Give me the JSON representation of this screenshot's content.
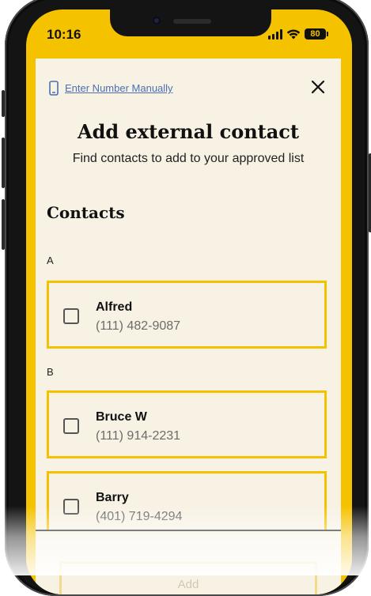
{
  "status_bar": {
    "time": "10:16",
    "battery": "80"
  },
  "header": {
    "manual_link_label": "Enter Number Manually",
    "title": "Add external contact",
    "subtitle": "Find contacts to add to your approved list"
  },
  "contacts": {
    "heading": "Contacts",
    "groups": [
      {
        "letter": "A",
        "items": [
          {
            "name": "Alfred",
            "phone": "(111) 482-9087",
            "checked": false
          }
        ]
      },
      {
        "letter": "B",
        "items": [
          {
            "name": "Bruce W",
            "phone": "(111) 914-2231",
            "checked": false
          },
          {
            "name": "Barry",
            "phone": "(401) 719-4294",
            "checked": false
          }
        ]
      }
    ]
  },
  "footer": {
    "add_label": "Add"
  },
  "colors": {
    "accent": "#f5c200",
    "sheet_background": "#f7f2e4",
    "link": "#4a6fb5"
  },
  "icons": {
    "phone": "phone-icon",
    "close": "close-icon",
    "checkbox": "checkbox-icon"
  }
}
